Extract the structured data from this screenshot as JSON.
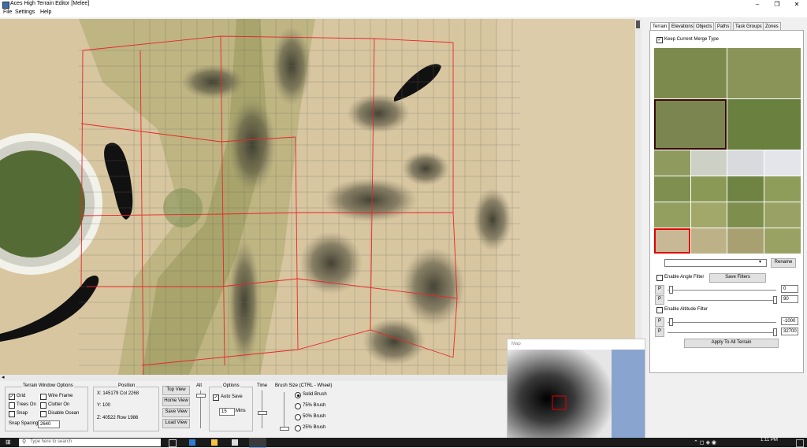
{
  "window": {
    "title": "Aces High Terrain Editor [Melee]",
    "minimize": "–",
    "maximize": "❐",
    "close": "✕"
  },
  "menu": [
    "File",
    "Settings",
    "Help"
  ],
  "tabs": [
    "Terrain",
    "Elevations",
    "Objects",
    "Paths",
    "Task Groups",
    "Zones"
  ],
  "terrain_tab": {
    "keep_merge": "Keep Current Merge Type",
    "rename": "Rename",
    "angle_filter": "Enable Angle Filter",
    "save_filters": "Save Filters",
    "p": "P",
    "angle_min": "0",
    "angle_max": "90",
    "altitude_filter": "Enable Altitude Filter",
    "alt_min": "-1000",
    "alt_max": "32700",
    "apply_all": "Apply To All Terrain"
  },
  "terrain_window_options": {
    "title": "Terrain Window Options",
    "grid": "Grid",
    "wire_frame": "Wire Frame",
    "trees_on": "Trees On",
    "clutter_on": "Clutter On",
    "snap": "Snap",
    "disable_ocean": "Disable Ocean",
    "snap_spacing_label": "Snap Spacing",
    "snap_spacing_value": "2640"
  },
  "position": {
    "title": "Position",
    "x": "X:  145179 Col 2268",
    "y": "Y:  100",
    "z": "Z:  40522  Row 1986"
  },
  "views": [
    "Top View",
    "Home View",
    "Save View",
    "Load View"
  ],
  "alt_label": "Alt",
  "options": {
    "title": "Options",
    "auto_save": "Auto Save",
    "mins_value": "15",
    "mins_label": "Mins"
  },
  "time_label": "Time",
  "brush": {
    "title": "Brush Size (CTRL - Wheel)",
    "items": [
      "Solid Brush",
      "75% Brush",
      "50% Brush",
      "25% Brush"
    ]
  },
  "map": {
    "title": "Map"
  },
  "taskbar": {
    "search": "Type here to search",
    "time": "1:11 PM",
    "date": "..."
  },
  "colors": {
    "grid_red": "#e8262a",
    "selection": "#e00000"
  }
}
